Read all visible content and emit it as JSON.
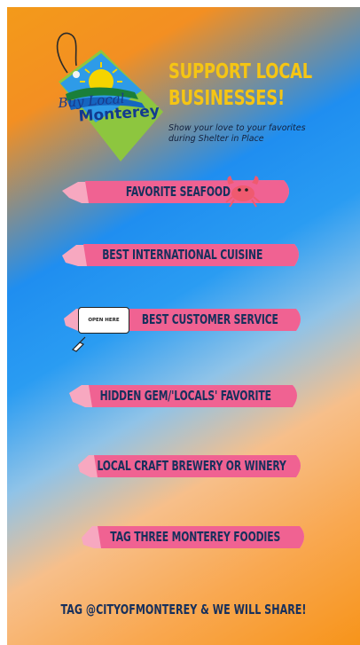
{
  "header": {
    "logo_line1": "Buy Local",
    "logo_line2": "Monterey",
    "headline_line1": "SUPPORT LOCAL",
    "headline_line2": "BUSINESSES!",
    "subline_line1": "Show your love to your favorites",
    "subline_line2": "during Shelter in Place"
  },
  "prompts": [
    {
      "label": "FAVORITE SEAFOOD"
    },
    {
      "label": "BEST INTERNATIONAL CUISINE"
    },
    {
      "label": "BEST CUSTOMER SERVICE"
    },
    {
      "label": "HIDDEN GEM/'LOCALS' FAVORITE"
    },
    {
      "label": "LOCAL CRAFT BREWERY OR WINERY"
    },
    {
      "label": "TAG THREE MONTEREY FOODIES"
    }
  ],
  "bell_text": "OPEN HERE",
  "footer": "TAG @CITYOFMONTEREY & WE WILL SHARE!",
  "colors": {
    "brush_pink": "#f06292",
    "brush_light": "#f7a8c0",
    "headline": "#f5c514",
    "label": "#17305c",
    "tag_green": "#8dc63f"
  }
}
